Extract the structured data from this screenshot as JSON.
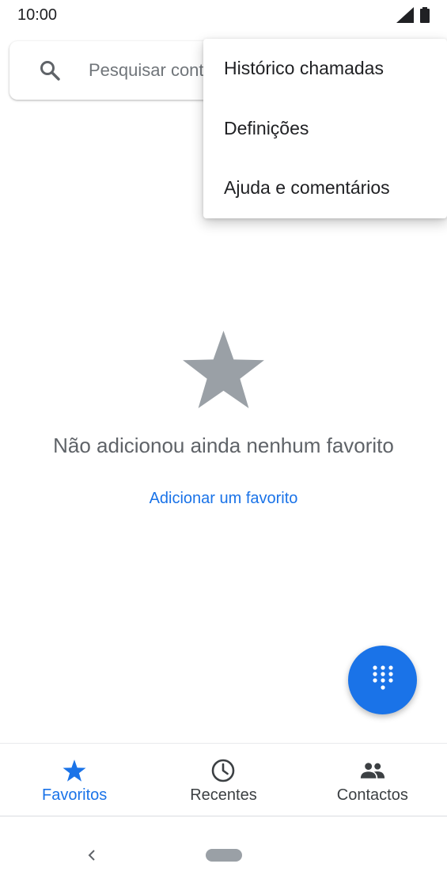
{
  "status_bar": {
    "time": "10:00"
  },
  "search": {
    "placeholder": "Pesquisar contactos",
    "icon": "search-icon"
  },
  "overflow_menu": {
    "items": [
      {
        "label": "Histórico chamadas"
      },
      {
        "label": "Definições"
      },
      {
        "label": "Ajuda e comentários"
      }
    ]
  },
  "empty_state": {
    "icon": "star-icon",
    "message": "Não adicionou ainda nenhum favorito",
    "action_label": "Adicionar um favorito"
  },
  "fab": {
    "icon": "dialpad-icon"
  },
  "bottom_nav": {
    "tabs": [
      {
        "label": "Favoritos",
        "icon": "star-icon",
        "active": true
      },
      {
        "label": "Recentes",
        "icon": "clock-icon",
        "active": false
      },
      {
        "label": "Contactos",
        "icon": "people-icon",
        "active": false
      }
    ]
  },
  "colors": {
    "accent": "#1a73e8",
    "text_primary": "#202124",
    "text_secondary": "#5f6368",
    "star_gray": "#9aa0a6"
  }
}
